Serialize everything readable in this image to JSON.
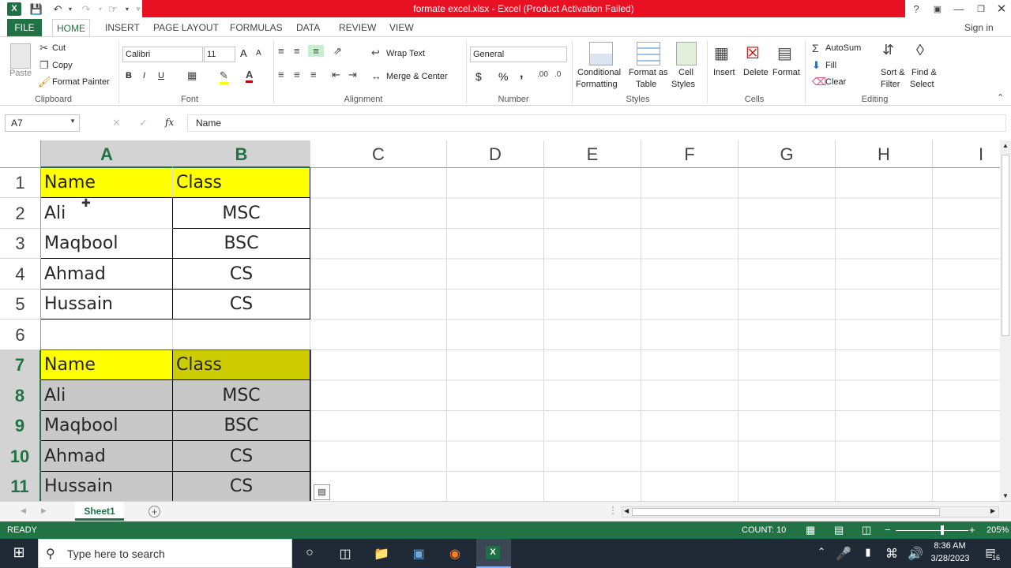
{
  "window": {
    "title": "formate excel.xlsx -  Excel (Product Activation Failed)",
    "help": "?",
    "sign_in": "Sign in"
  },
  "tabs": [
    "FILE",
    "HOME",
    "INSERT",
    "PAGE LAYOUT",
    "FORMULAS",
    "DATA",
    "REVIEW",
    "VIEW"
  ],
  "ribbon": {
    "clipboard": {
      "paste": "Paste",
      "cut": "Cut",
      "copy": "Copy",
      "format_painter": "Format Painter",
      "label": "Clipboard"
    },
    "font": {
      "name": "Calibri",
      "size": "11",
      "bold": "B",
      "italic": "I",
      "underline": "U",
      "grow": "A",
      "shrink": "A",
      "label": "Font"
    },
    "alignment": {
      "wrap": "Wrap Text",
      "merge": "Merge & Center",
      "label": "Alignment"
    },
    "number": {
      "format": "General",
      "currency": "$",
      "percent": "%",
      "comma": ",",
      "label": "Number"
    },
    "styles": {
      "conditional": "Conditional",
      "conditional2": "Formatting",
      "format_as": "Format as",
      "format_as2": "Table",
      "cell": "Cell",
      "cell2": "Styles",
      "label": "Styles"
    },
    "cells": {
      "insert": "Insert",
      "delete": "Delete",
      "format": "Format",
      "label": "Cells"
    },
    "editing": {
      "autosum": "AutoSum",
      "fill": "Fill",
      "clear": "Clear",
      "sort": "Sort &",
      "sort2": "Filter",
      "find": "Find &",
      "find2": "Select",
      "label": "Editing"
    }
  },
  "formula_bar": {
    "name_box": "A7",
    "fx": "fx",
    "value": "Name"
  },
  "columns": [
    "A",
    "B",
    "C",
    "D",
    "E",
    "F",
    "G",
    "H",
    "I"
  ],
  "rows": [
    "1",
    "2",
    "3",
    "4",
    "5",
    "6",
    "7",
    "8",
    "9",
    "10",
    "11"
  ],
  "table1": {
    "header": [
      "Name",
      "Class"
    ],
    "rows": [
      [
        "Ali",
        "MSC"
      ],
      [
        "Maqbool",
        "BSC"
      ],
      [
        "Ahmad",
        "CS"
      ],
      [
        "Hussain",
        "CS"
      ]
    ]
  },
  "table2": {
    "header": [
      "Name",
      "Class"
    ],
    "rows": [
      [
        "Ali",
        "MSC"
      ],
      [
        "Maqbool",
        "BSC"
      ],
      [
        "Ahmad",
        "CS"
      ],
      [
        "Hussain",
        "CS"
      ]
    ]
  },
  "sheet": {
    "tab": "Sheet1",
    "add": "+"
  },
  "status": {
    "ready": "READY",
    "count": "COUNT: 10",
    "zoom": "205%"
  },
  "taskbar": {
    "search": "Type here to search",
    "time": "8:36 AM",
    "date": "3/28/2023",
    "notif": "16"
  },
  "colors": {
    "excel_green": "#217346",
    "header_yellow": "#ffff00",
    "title_red": "#e81123"
  }
}
